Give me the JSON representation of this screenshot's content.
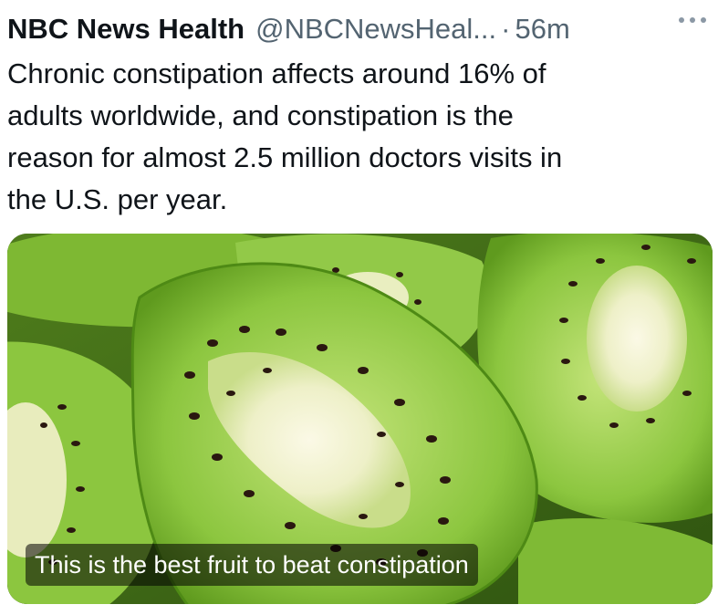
{
  "post": {
    "author_name": "NBC News Health",
    "author_handle": "@NBCNewsHeal...",
    "separator": "·",
    "timestamp": "56m",
    "more_icon": "more-horizontal-icon",
    "text": "Chronic constipation affects around 16% of\nadults worldwide, and constipation is the\nreason for almost 2.5 million doctors visits in\nthe U.S. per year."
  },
  "media": {
    "image_subject": "sliced kiwi fruit",
    "caption": "This is the best fruit to beat constipation"
  },
  "colors": {
    "text_primary": "#0f1419",
    "text_secondary": "#536471",
    "kiwi_green": "#8cc63f",
    "kiwi_flesh": "#a7d85a",
    "kiwi_core": "#f3f1d6",
    "kiwi_seed": "#2a1810"
  }
}
